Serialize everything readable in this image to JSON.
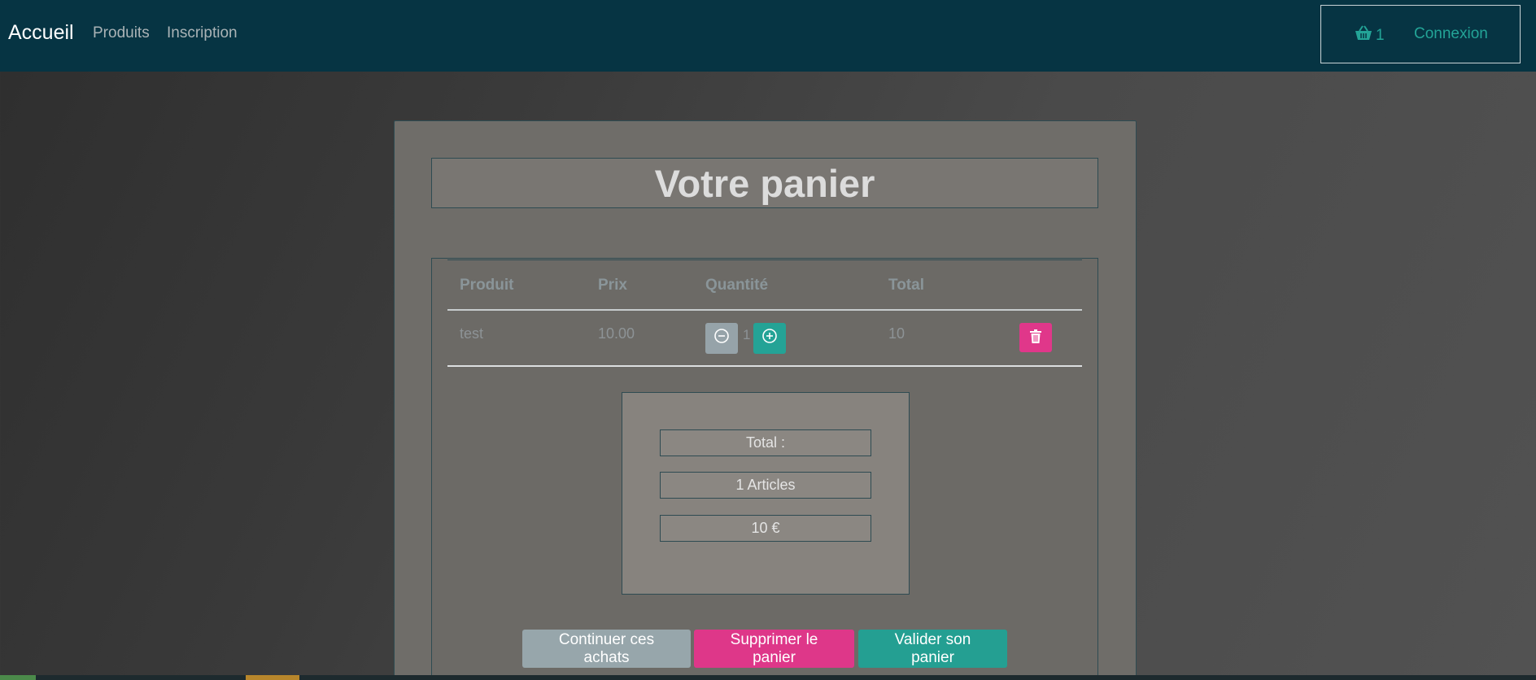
{
  "navbar": {
    "brand": "Accueil",
    "links": [
      "Produits",
      "Inscription"
    ],
    "cart_count": "1",
    "login": "Connexion",
    "colors": {
      "background": "#063443",
      "accent": "#23a497"
    }
  },
  "page": {
    "title": "Votre panier"
  },
  "cart_table": {
    "headers": [
      "Produit",
      "Prix",
      "Quantité",
      "Total"
    ],
    "rows": [
      {
        "product": "test",
        "price": "10.00",
        "quantity": "1",
        "total": "10"
      }
    ]
  },
  "summary": {
    "label": "Total :",
    "articles": "1 Articles",
    "amount": "10 €"
  },
  "actions": {
    "continue": "Continuer ces achats",
    "clear": "Supprimer le panier",
    "validate": "Valider son panier"
  },
  "icons": {
    "cart": "basket-icon",
    "minus": "minus-circle-icon",
    "plus": "plus-circle-icon",
    "delete": "trash-icon"
  }
}
